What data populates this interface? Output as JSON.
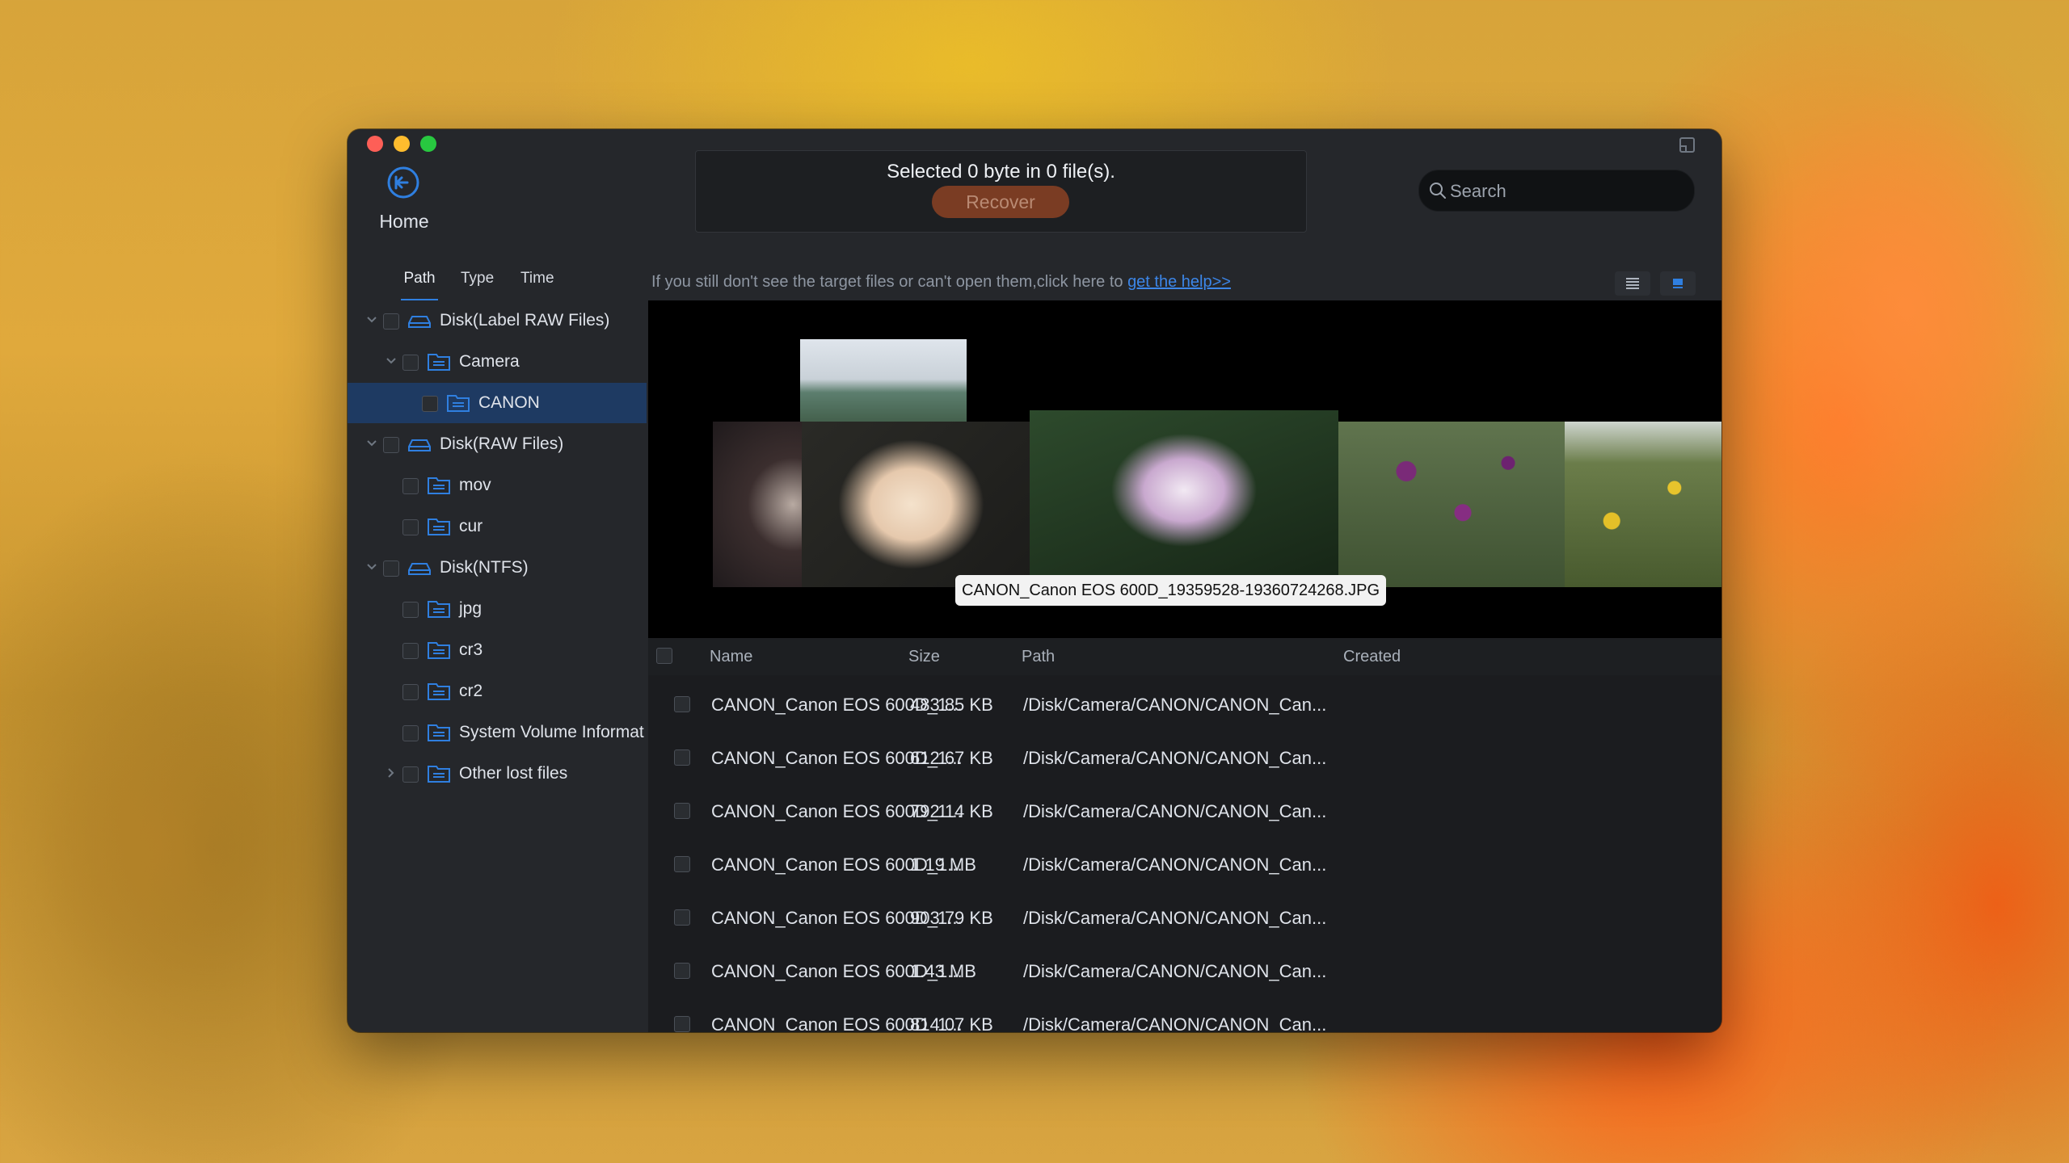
{
  "window": {
    "home_label": "Home",
    "selection_text": "Selected 0 byte in 0 file(s).",
    "recover_label": "Recover",
    "search_placeholder": "Search"
  },
  "tabs": [
    {
      "label": "Path",
      "active": true
    },
    {
      "label": "Type",
      "active": false
    },
    {
      "label": "Time",
      "active": false
    }
  ],
  "hint": {
    "text": "If you still don't see the target files or can't open them,click here to",
    "link": "get the help>>"
  },
  "tree": [
    {
      "label": "Disk(Label RAW Files)",
      "icon": "disk-icon",
      "expanded": true
    },
    {
      "label": "Camera",
      "icon": "folder-icon",
      "expanded": true
    },
    {
      "label": "CANON",
      "icon": "folder-icon",
      "selected": true
    },
    {
      "label": "Disk(RAW Files)",
      "icon": "disk-icon",
      "expanded": true
    },
    {
      "label": "mov",
      "icon": "folder-icon"
    },
    {
      "label": "cur",
      "icon": "folder-icon"
    },
    {
      "label": "Disk(NTFS)",
      "icon": "disk-icon",
      "expanded": true
    },
    {
      "label": "jpg",
      "icon": "folder-icon"
    },
    {
      "label": "cr3",
      "icon": "folder-icon"
    },
    {
      "label": "cr2",
      "icon": "folder-icon"
    },
    {
      "label": "System Volume Informat",
      "icon": "folder-icon"
    },
    {
      "label": "Other lost files",
      "icon": "folder-icon",
      "expandable": true
    }
  ],
  "preview": {
    "tooltip": "CANON_Canon EOS 600D_19359528-19360724268.JPG"
  },
  "table": {
    "columns": [
      "Name",
      "Size",
      "Path",
      "Created"
    ],
    "rows": [
      {
        "name": "CANON_Canon EOS 600D_1...",
        "size": "483.85 KB",
        "path": "/Disk/Camera/CANON/CANON_Can..."
      },
      {
        "name": "CANON_Canon EOS 600D_1...",
        "size": "612.67 KB",
        "path": "/Disk/Camera/CANON/CANON_Can..."
      },
      {
        "name": "CANON_Canon EOS 600D_1...",
        "size": "792.14 KB",
        "path": "/Disk/Camera/CANON/CANON_Can..."
      },
      {
        "name": "CANON_Canon EOS 600D_1...",
        "size": "1.19 MB",
        "path": "/Disk/Camera/CANON/CANON_Can..."
      },
      {
        "name": "CANON_Canon EOS 600D_1...",
        "size": "903.79 KB",
        "path": "/Disk/Camera/CANON/CANON_Can..."
      },
      {
        "name": "CANON_Canon EOS 600D_1...",
        "size": "1.43 MB",
        "path": "/Disk/Camera/CANON/CANON_Can..."
      },
      {
        "name": "CANON_Canon EOS 600D_1...",
        "size": "814.07 KB",
        "path": "/Disk/Camera/CANON/CANON_Can..."
      }
    ]
  },
  "colors": {
    "accent": "#2f7fe0",
    "recover_button": "#7a3c23",
    "selected_row": "#1e3a62"
  }
}
